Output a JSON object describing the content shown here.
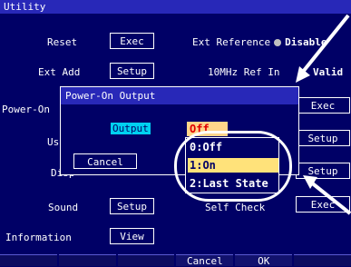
{
  "window": {
    "title": "Utility"
  },
  "rows_left": [
    {
      "label": "Reset",
      "button": "Exec"
    },
    {
      "label": "Ext Add",
      "button": "Setup"
    },
    {
      "label": "Power-On",
      "button": ""
    },
    {
      "label": "User",
      "button": ""
    },
    {
      "label": "Disp",
      "button": ""
    },
    {
      "label": "Sound",
      "button": "Setup"
    },
    {
      "label": "Information",
      "button": "View"
    }
  ],
  "right": {
    "ext_reference_label": "Ext Reference",
    "ext_reference_value": "Disable",
    "ref_10mhz_label": "10MHz Ref In",
    "ref_10mhz_value": "Valid",
    "self_check_label": "Self Check",
    "buttons": [
      "Exec",
      "Setup",
      "Setup",
      "Exec"
    ]
  },
  "dialog": {
    "title": "Power-On Output",
    "output_label": "Output",
    "output_value": "Off",
    "cancel_label": "Cancel"
  },
  "dropdown": {
    "options": [
      "0:Off",
      "1:On",
      "2:Last State"
    ],
    "selected_index": 1
  },
  "footer": {
    "keys": [
      "",
      "",
      "",
      "Cancel",
      "OK",
      ""
    ]
  },
  "colors": {
    "background": "#000066",
    "title_bar": "#2828b8",
    "highlight_cyan": "#00d0f0",
    "value_bg": "#ffd58a",
    "value_text": "#e00000",
    "selected_option": "#ffe27a"
  }
}
